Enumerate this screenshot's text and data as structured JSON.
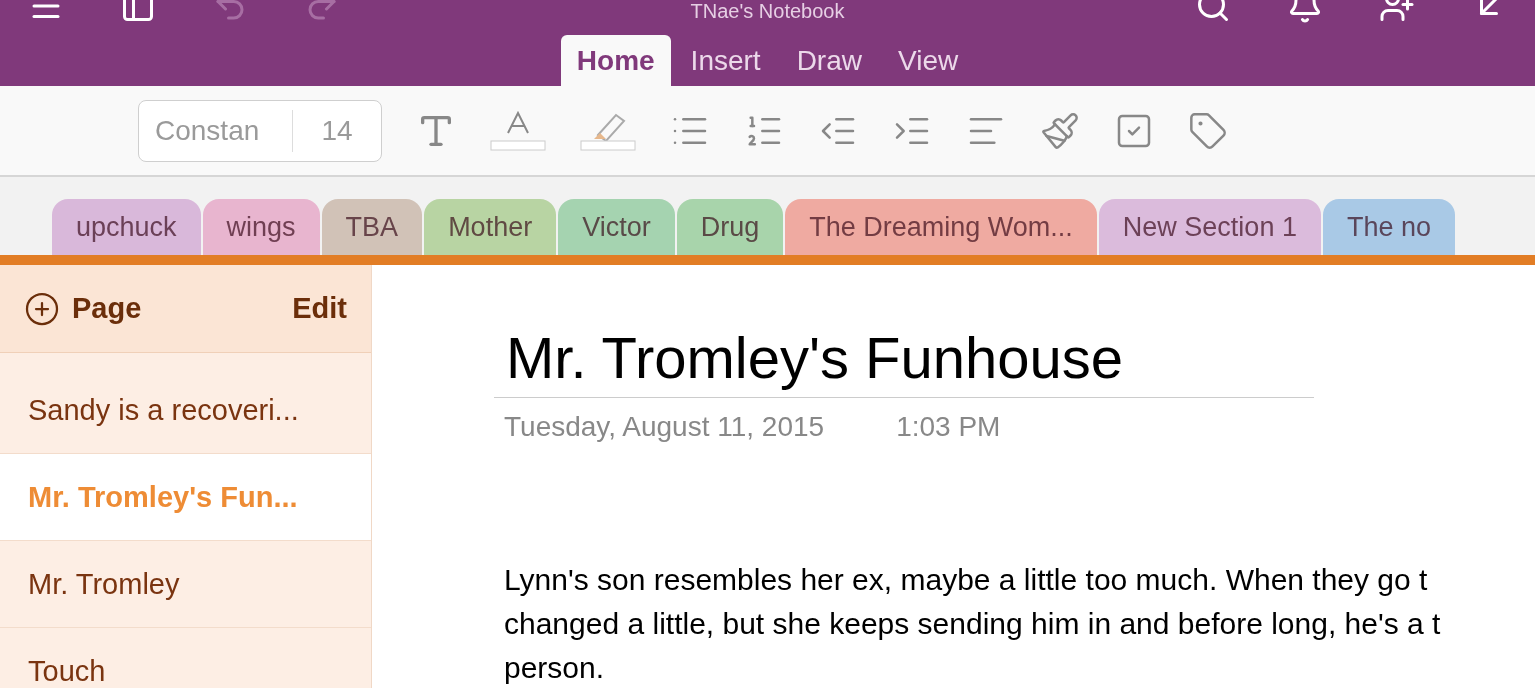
{
  "notebook_title": "TNae's Notebook",
  "ribbon_tabs": [
    {
      "label": "Home",
      "selected": true
    },
    {
      "label": "Insert",
      "selected": false
    },
    {
      "label": "Draw",
      "selected": false
    },
    {
      "label": "View",
      "selected": false
    }
  ],
  "toolbar": {
    "font": "Constan",
    "size": "14"
  },
  "sections": [
    {
      "label": "upchuck",
      "color": "#d9b8da"
    },
    {
      "label": "wings",
      "color": "#e8b5cf"
    },
    {
      "label": "TBA",
      "color": "#d1c2b7"
    },
    {
      "label": "Mother",
      "color": "#b8d4a3"
    },
    {
      "label": "Victor",
      "color": "#a5d3b0"
    },
    {
      "label": "Drug",
      "color": "#a8d4ab"
    },
    {
      "label": "The Dreaming Wom...",
      "color": "#efaaa1"
    },
    {
      "label": "New Section 1",
      "color": "#dbbbdc"
    },
    {
      "label": "The no",
      "color": "#a9c9e6"
    }
  ],
  "page_list": {
    "add_label": "Page",
    "edit_label": "Edit",
    "pages": [
      {
        "title": "Sandy  is a recoveri...",
        "selected": false
      },
      {
        "title": "Mr. Tromley's Fun...",
        "selected": true
      },
      {
        "title": "Mr. Tromley",
        "selected": false
      },
      {
        "title": "Touch",
        "selected": false
      }
    ]
  },
  "page": {
    "title": "Mr. Tromley's Funhouse",
    "date": "Tuesday, August 11, 2015",
    "time": "1:03 PM",
    "lines": [
      "Lynn's son resembles her ex, maybe a little too much. When they go t",
      "changed a little, but she keeps sending him in and before long, he's a t",
      "person."
    ]
  }
}
